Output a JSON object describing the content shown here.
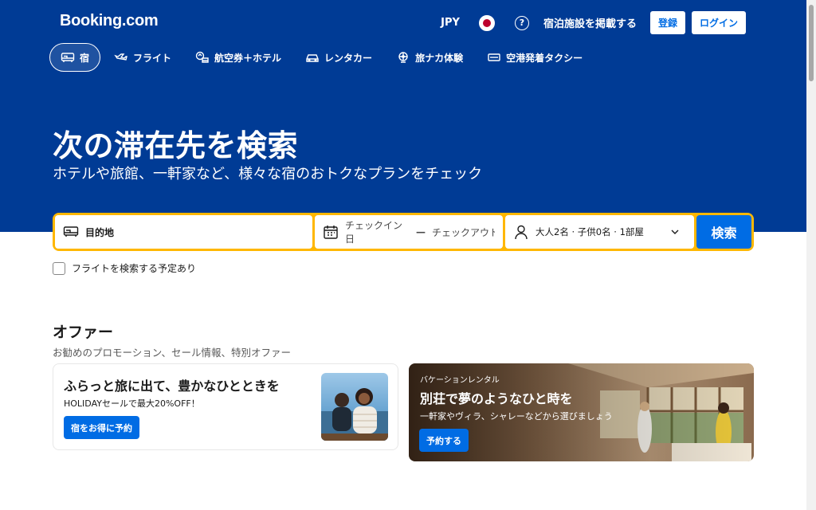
{
  "header": {
    "logo": "Booking.com",
    "currency": "JPY",
    "flag_icon": "japan-flag-icon",
    "help_icon": "question-circle-icon",
    "help_glyph": "?",
    "list_property": "宿泊施設を掲載する",
    "register": "登録",
    "login": "ログイン"
  },
  "nav": {
    "items": [
      {
        "label": "宿",
        "icon": "bed-icon",
        "active": true
      },
      {
        "label": "フライト",
        "icon": "plane-icon",
        "active": false
      },
      {
        "label": "航空券＋ホテル",
        "icon": "plane-bed-icon",
        "active": false
      },
      {
        "label": "レンタカー",
        "icon": "car-icon",
        "active": false
      },
      {
        "label": "旅ナカ体験",
        "icon": "attractions-icon",
        "active": false
      },
      {
        "label": "空港発着タクシー",
        "icon": "taxi-icon",
        "active": false
      }
    ]
  },
  "hero": {
    "headline": "次の滞在先を検索",
    "subline": "ホテルや旅館、一軒家など、様々な宿のおトクなプランをチェック"
  },
  "search": {
    "destination_placeholder": "目的地",
    "checkin": "チェックイン日",
    "dash": "—",
    "checkout": "チェックアウト日",
    "guests": "大人2名 · 子供0名 · 1部屋",
    "search_button": "検索",
    "flight_checkbox_label": "フライトを検索する予定あり"
  },
  "offers": {
    "title": "オファー",
    "subtitle": "お勧めのプロモーション、セール情報、特別オファー",
    "card1": {
      "title": "ふらっと旅に出て、豊かなひとときを",
      "subtitle": "HOLIDAYセールで最大20%OFF！",
      "button": "宿をお得に予約"
    },
    "card2": {
      "overline": "バケーションレンタル",
      "title": "別荘で夢のようなひと時を",
      "subtitle": "一軒家やヴィラ、シャレーなどから選びましょう",
      "button": "予約する"
    }
  },
  "colors": {
    "brand_blue": "#003b95",
    "action_blue": "#006ce4",
    "search_border": "#ffb700"
  }
}
